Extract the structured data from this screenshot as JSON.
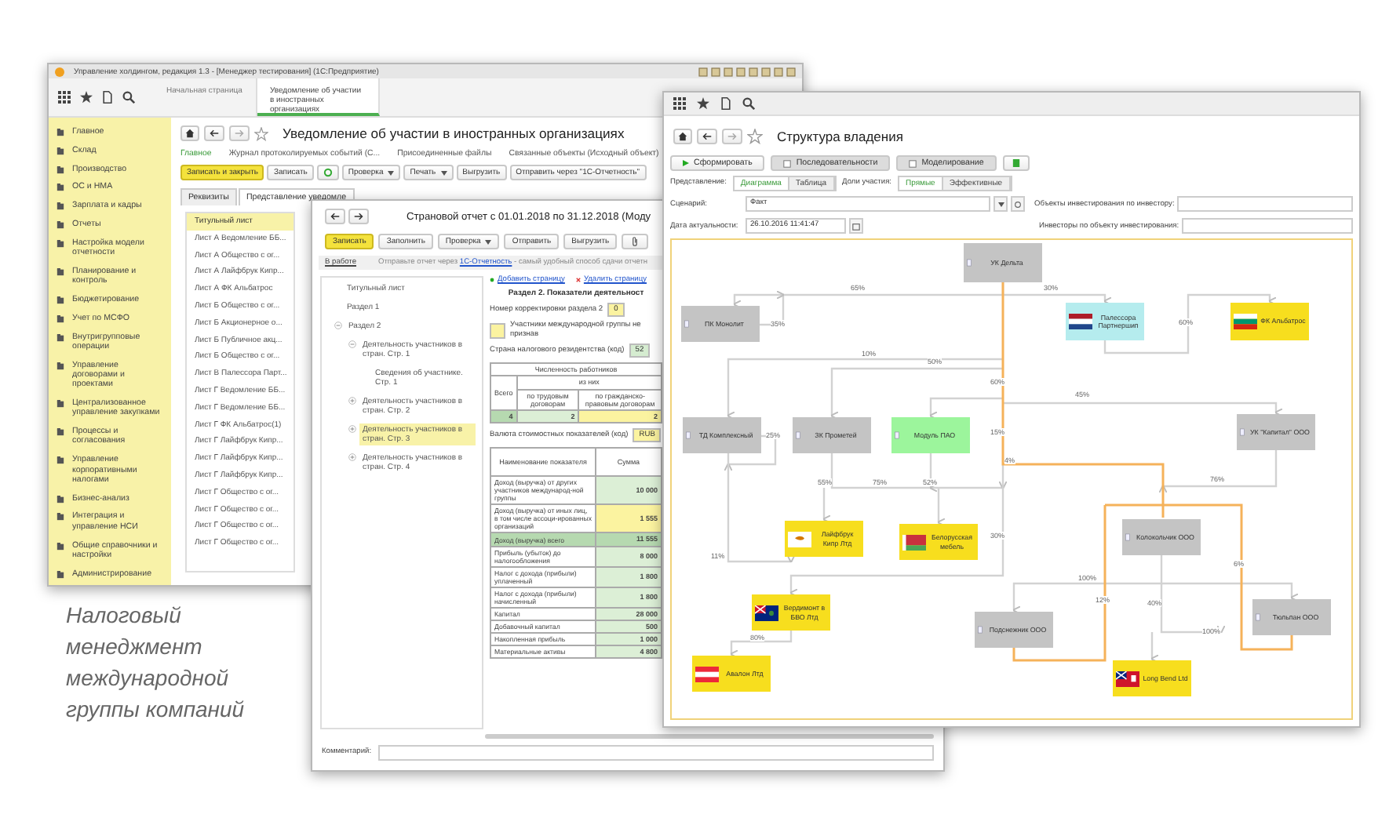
{
  "main_window": {
    "title": "Управление холдингом, редакция 1.3 - [Менеджер тестирования] (1С:Предприятие)",
    "tabs": [
      {
        "label": "Начальная страница",
        "selected": false
      },
      {
        "label": "Уведомление об участии в иностранных организациях",
        "selected": true
      }
    ],
    "sections": [
      "Главное",
      "Склад",
      "Производство",
      "ОС и НМА",
      "Зарплата и кадры",
      "Отчеты",
      "Настройка модели отчетности",
      "Планирование и контроль",
      "Бюджетирование",
      "Учет по МСФО",
      "Внутригрупповые операции",
      "Управление договорами и проектами",
      "Централизованное управление закупками",
      "Процессы и согласования",
      "Управление корпоративными налогами",
      "Бизнес-анализ",
      "Интеграция и управление НСИ",
      "Общие справочники и настройки",
      "Администрирование"
    ],
    "document_title": "Уведомление об участии в иностранных организациях",
    "links": [
      {
        "label": "Главное",
        "selected": true
      },
      {
        "label": "Журнал протоколируемых событий (С...",
        "selected": false
      },
      {
        "label": "Присоединенные файлы",
        "selected": false
      },
      {
        "label": "Связанные объекты (Исходный объект)",
        "selected": false
      }
    ],
    "buttons": [
      {
        "kind": "primary",
        "label": "Записать и закрыть"
      },
      {
        "kind": "plain",
        "label": "Записать"
      },
      {
        "kind": "icon"
      },
      {
        "kind": "menu",
        "label": "Проверка"
      },
      {
        "kind": "menu",
        "label": "Печать"
      },
      {
        "kind": "plain",
        "label": "Выгрузить"
      },
      {
        "kind": "plain",
        "label": "Отправить через \"1С-Отчетность\""
      }
    ],
    "form_tabs": [
      {
        "label": "Реквизиты",
        "selected": false
      },
      {
        "label": "Представление уведомле",
        "selected": true
      }
    ],
    "sheets": [
      {
        "label": "Титульный лист",
        "selected": true
      },
      {
        "label": "Лист А Ведомление ББ...",
        "selected": false
      },
      {
        "label": "Лист А Общество с ог...",
        "selected": false
      },
      {
        "label": "Лист А Лайфбрук Кипр...",
        "selected": false
      },
      {
        "label": "Лист А ФК Альбатрос",
        "selected": false
      },
      {
        "label": "Лист Б Общество с ог...",
        "selected": false
      },
      {
        "label": "Лист Б Акционерное о...",
        "selected": false
      },
      {
        "label": "Лист Б Публичное акц...",
        "selected": false
      },
      {
        "label": "Лист Б Общество с ог...",
        "selected": false
      },
      {
        "label": "Лист В Палессора Парт...",
        "selected": false
      },
      {
        "label": "Лист Г Ведомление ББ...",
        "selected": false
      },
      {
        "label": "Лист Г Ведомление ББ...",
        "selected": false
      },
      {
        "label": "Лист Г ФК Альбатрос(1)",
        "selected": false
      },
      {
        "label": "Лист Г Лайфбрук Кипр...",
        "selected": false
      },
      {
        "label": "Лист Г Лайфбрук Кипр...",
        "selected": false
      },
      {
        "label": "Лист Г Лайфбрук Кипр...",
        "selected": false
      },
      {
        "label": "Лист Г Общество с ог...",
        "selected": false
      },
      {
        "label": "Лист Г Общество с ог...",
        "selected": false
      },
      {
        "label": "Лист Г Общество с ог...",
        "selected": false
      },
      {
        "label": "Лист Г Общество с ог...",
        "selected": false
      }
    ]
  },
  "report_window": {
    "title": "Страновой отчет с 01.01.2018 по 31.12.2018 (Моду",
    "buttons": [
      {
        "kind": "primary",
        "label": "Записать"
      },
      {
        "kind": "plain",
        "label": "Заполнить"
      },
      {
        "kind": "menu",
        "label": "Проверка"
      },
      {
        "kind": "plain",
        "label": "Отправить"
      },
      {
        "kind": "plain",
        "label": "Выгрузить"
      },
      {
        "kind": "clip"
      }
    ],
    "status_link": "В работе",
    "hint": {
      "before": "Отправьте отчет через ",
      "link": "1С-Отчетность",
      "after": " - самый удобный способ сдачи отчетн"
    },
    "tree": [
      {
        "label": "Титульный лист",
        "selected": false
      },
      {
        "label": "Раздел 1",
        "selected": false
      },
      {
        "label": "Раздел 2",
        "selected": false,
        "expanded": true,
        "children": [
          {
            "label": "Деятельность участников в стран. Стр. 1",
            "selected": false,
            "expanded": true,
            "children": [
              {
                "label": "Сведения об участнике. Стр. 1",
                "selected": false
              }
            ]
          },
          {
            "label": "Деятельность участников в стран. Стр. 2",
            "selected": false,
            "expanded": false
          },
          {
            "label": "Деятельность участников в стран. Стр. 3",
            "selected": true,
            "expanded": false
          },
          {
            "label": "Деятельность участников в стран. Стр. 4",
            "selected": false,
            "expanded": false
          }
        ]
      }
    ],
    "page_actions": [
      {
        "kind": "add",
        "label": "Добавить страницу"
      },
      {
        "kind": "remove",
        "label": "Удалить страницу"
      }
    ],
    "heading": "Раздел 2. Показатели деятельност",
    "correction": {
      "label": "Номер корректировки раздела 2",
      "value": "0"
    },
    "not_recognized": {
      "label": "Участники международной группы не признав",
      "checked": false
    },
    "country": {
      "label": "Страна налогового резидентства (код)",
      "value": "52"
    },
    "staff": {
      "title": "Численность работников",
      "total": "Всего",
      "of_which": "из них",
      "columns": [
        "по трудовым договорам",
        "по гражданско-правовым договорам"
      ],
      "values": [
        "4",
        "2",
        "2"
      ]
    },
    "currency": {
      "label": "Валюта стоимостных показателей (код)",
      "value": "RUB"
    },
    "indicators": {
      "columns": [
        "Наименование показателя",
        "Сумма"
      ],
      "rows": [
        {
          "name": "Доход (выручка) от других участников международ-ной группы",
          "value": "10 000",
          "kind": "computed"
        },
        {
          "name": "Доход (выручка) от иных лиц, в том числе ассоци-ированных организаций",
          "value": "1 555",
          "kind": "input"
        },
        {
          "name": "Доход (выручка) всего",
          "value": "11 555",
          "kind": "total"
        },
        {
          "name": "Прибыль (убыток) до налогообложения",
          "value": "8 000",
          "kind": "computed"
        },
        {
          "name": "Налог с дохода (прибыли) уплаченный",
          "value": "1 800",
          "kind": "computed"
        },
        {
          "name": "Налог с дохода (прибыли) начисленный",
          "value": "1 800",
          "kind": "computed"
        },
        {
          "name": "Капитал",
          "value": "28 000",
          "kind": "computed"
        },
        {
          "name": "Добавочный капитал",
          "value": "500",
          "kind": "computed"
        },
        {
          "name": "Накопленная прибыль",
          "value": "1 000",
          "kind": "computed"
        },
        {
          "name": "Материальные активы",
          "value": "4 800",
          "kind": "computed"
        }
      ]
    },
    "comment_label": "Комментарий:"
  },
  "ownership_window": {
    "title": "Структура владения",
    "buttons": [
      {
        "kind": "run",
        "label": "Сформировать"
      },
      {
        "kind": "view",
        "label": "Последовательности"
      },
      {
        "kind": "view",
        "label": "Моделирование"
      },
      {
        "kind": "icon"
      }
    ],
    "view": {
      "label": "Представление:",
      "options": [
        {
          "label": "Диаграмма",
          "selected": true
        },
        {
          "label": "Таблица",
          "selected": false
        }
      ]
    },
    "shares": {
      "label": "Доли участия:",
      "options": [
        {
          "label": "Прямые",
          "selected": true
        },
        {
          "label": "Эффективные",
          "selected": false
        }
      ]
    },
    "scenario": {
      "label": "Сценарий:",
      "value": "Факт"
    },
    "date": {
      "label": "Дата актуальности:",
      "value": "26.10.2016 11:41:47"
    },
    "investees": {
      "label": "Объекты инвестирования по инвестору:"
    },
    "investors": {
      "label": "Инвесторы по объекту инвестирования:"
    },
    "nodes": [
      {
        "name": "УК Дельта",
        "kind": "company",
        "color": "#c4c4c4"
      },
      {
        "name": "ПК Монолит",
        "kind": "company",
        "color": "#c4c4c4"
      },
      {
        "name": "Палессора Партнершип",
        "kind": "foreign",
        "color": "#b5ecee"
      },
      {
        "name": "ФК Альбатрос",
        "kind": "foreign",
        "color": "#f7de1e"
      },
      {
        "name": "ТД Комплексный",
        "kind": "company",
        "color": "#c4c4c4"
      },
      {
        "name": "ЗК Прометей",
        "kind": "company",
        "color": "#c4c4c4"
      },
      {
        "name": "Модуль ПАО",
        "kind": "company",
        "color": "#9cf59c"
      },
      {
        "name": "УК \"Капитал\" ООО",
        "kind": "company",
        "color": "#c4c4c4"
      },
      {
        "name": "Лайфбрук Кипр Лтд",
        "kind": "foreign",
        "color": "#f7de1e"
      },
      {
        "name": "Белорусская мебель",
        "kind": "foreign",
        "color": "#f7de1e"
      },
      {
        "name": "Колокольчик ООО",
        "kind": "company",
        "color": "#c4c4c4"
      },
      {
        "name": "Вердимонт в БВО Лтд",
        "kind": "foreign",
        "color": "#f7de1e"
      },
      {
        "name": "Подснежник ООО",
        "kind": "company",
        "color": "#c4c4c4"
      },
      {
        "name": "Тюльпан ООО",
        "kind": "company",
        "color": "#c4c4c4"
      },
      {
        "name": "Авалон Лтд",
        "kind": "foreign",
        "color": "#f7de1e"
      },
      {
        "name": "Long Bend Ltd",
        "kind": "foreign",
        "color": "#f7de1e"
      }
    ],
    "shares_labels": [
      "65%",
      "30%",
      "35%",
      "60%",
      "10%",
      "50%",
      "60%",
      "45%",
      "25%",
      "15%",
      "4%",
      "76%",
      "55%",
      "75%",
      "52%",
      "30%",
      "11%",
      "6%",
      "100%",
      "12%",
      "40%",
      "100%",
      "80%"
    ]
  },
  "caption": "Налоговый менеджмент международной группы компаний"
}
